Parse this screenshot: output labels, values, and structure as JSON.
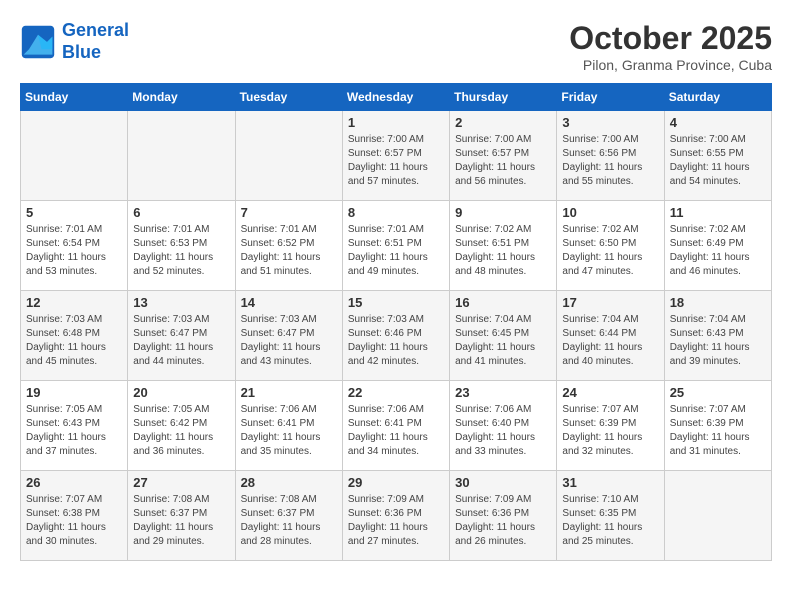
{
  "header": {
    "logo_line1": "General",
    "logo_line2": "Blue",
    "month_year": "October 2025",
    "location": "Pilon, Granma Province, Cuba"
  },
  "weekdays": [
    "Sunday",
    "Monday",
    "Tuesday",
    "Wednesday",
    "Thursday",
    "Friday",
    "Saturday"
  ],
  "weeks": [
    [
      {
        "day": "",
        "info": ""
      },
      {
        "day": "",
        "info": ""
      },
      {
        "day": "",
        "info": ""
      },
      {
        "day": "1",
        "info": "Sunrise: 7:00 AM\nSunset: 6:57 PM\nDaylight: 11 hours and 57 minutes."
      },
      {
        "day": "2",
        "info": "Sunrise: 7:00 AM\nSunset: 6:57 PM\nDaylight: 11 hours and 56 minutes."
      },
      {
        "day": "3",
        "info": "Sunrise: 7:00 AM\nSunset: 6:56 PM\nDaylight: 11 hours and 55 minutes."
      },
      {
        "day": "4",
        "info": "Sunrise: 7:00 AM\nSunset: 6:55 PM\nDaylight: 11 hours and 54 minutes."
      }
    ],
    [
      {
        "day": "5",
        "info": "Sunrise: 7:01 AM\nSunset: 6:54 PM\nDaylight: 11 hours and 53 minutes."
      },
      {
        "day": "6",
        "info": "Sunrise: 7:01 AM\nSunset: 6:53 PM\nDaylight: 11 hours and 52 minutes."
      },
      {
        "day": "7",
        "info": "Sunrise: 7:01 AM\nSunset: 6:52 PM\nDaylight: 11 hours and 51 minutes."
      },
      {
        "day": "8",
        "info": "Sunrise: 7:01 AM\nSunset: 6:51 PM\nDaylight: 11 hours and 49 minutes."
      },
      {
        "day": "9",
        "info": "Sunrise: 7:02 AM\nSunset: 6:51 PM\nDaylight: 11 hours and 48 minutes."
      },
      {
        "day": "10",
        "info": "Sunrise: 7:02 AM\nSunset: 6:50 PM\nDaylight: 11 hours and 47 minutes."
      },
      {
        "day": "11",
        "info": "Sunrise: 7:02 AM\nSunset: 6:49 PM\nDaylight: 11 hours and 46 minutes."
      }
    ],
    [
      {
        "day": "12",
        "info": "Sunrise: 7:03 AM\nSunset: 6:48 PM\nDaylight: 11 hours and 45 minutes."
      },
      {
        "day": "13",
        "info": "Sunrise: 7:03 AM\nSunset: 6:47 PM\nDaylight: 11 hours and 44 minutes."
      },
      {
        "day": "14",
        "info": "Sunrise: 7:03 AM\nSunset: 6:47 PM\nDaylight: 11 hours and 43 minutes."
      },
      {
        "day": "15",
        "info": "Sunrise: 7:03 AM\nSunset: 6:46 PM\nDaylight: 11 hours and 42 minutes."
      },
      {
        "day": "16",
        "info": "Sunrise: 7:04 AM\nSunset: 6:45 PM\nDaylight: 11 hours and 41 minutes."
      },
      {
        "day": "17",
        "info": "Sunrise: 7:04 AM\nSunset: 6:44 PM\nDaylight: 11 hours and 40 minutes."
      },
      {
        "day": "18",
        "info": "Sunrise: 7:04 AM\nSunset: 6:43 PM\nDaylight: 11 hours and 39 minutes."
      }
    ],
    [
      {
        "day": "19",
        "info": "Sunrise: 7:05 AM\nSunset: 6:43 PM\nDaylight: 11 hours and 37 minutes."
      },
      {
        "day": "20",
        "info": "Sunrise: 7:05 AM\nSunset: 6:42 PM\nDaylight: 11 hours and 36 minutes."
      },
      {
        "day": "21",
        "info": "Sunrise: 7:06 AM\nSunset: 6:41 PM\nDaylight: 11 hours and 35 minutes."
      },
      {
        "day": "22",
        "info": "Sunrise: 7:06 AM\nSunset: 6:41 PM\nDaylight: 11 hours and 34 minutes."
      },
      {
        "day": "23",
        "info": "Sunrise: 7:06 AM\nSunset: 6:40 PM\nDaylight: 11 hours and 33 minutes."
      },
      {
        "day": "24",
        "info": "Sunrise: 7:07 AM\nSunset: 6:39 PM\nDaylight: 11 hours and 32 minutes."
      },
      {
        "day": "25",
        "info": "Sunrise: 7:07 AM\nSunset: 6:39 PM\nDaylight: 11 hours and 31 minutes."
      }
    ],
    [
      {
        "day": "26",
        "info": "Sunrise: 7:07 AM\nSunset: 6:38 PM\nDaylight: 11 hours and 30 minutes."
      },
      {
        "day": "27",
        "info": "Sunrise: 7:08 AM\nSunset: 6:37 PM\nDaylight: 11 hours and 29 minutes."
      },
      {
        "day": "28",
        "info": "Sunrise: 7:08 AM\nSunset: 6:37 PM\nDaylight: 11 hours and 28 minutes."
      },
      {
        "day": "29",
        "info": "Sunrise: 7:09 AM\nSunset: 6:36 PM\nDaylight: 11 hours and 27 minutes."
      },
      {
        "day": "30",
        "info": "Sunrise: 7:09 AM\nSunset: 6:36 PM\nDaylight: 11 hours and 26 minutes."
      },
      {
        "day": "31",
        "info": "Sunrise: 7:10 AM\nSunset: 6:35 PM\nDaylight: 11 hours and 25 minutes."
      },
      {
        "day": "",
        "info": ""
      }
    ]
  ]
}
